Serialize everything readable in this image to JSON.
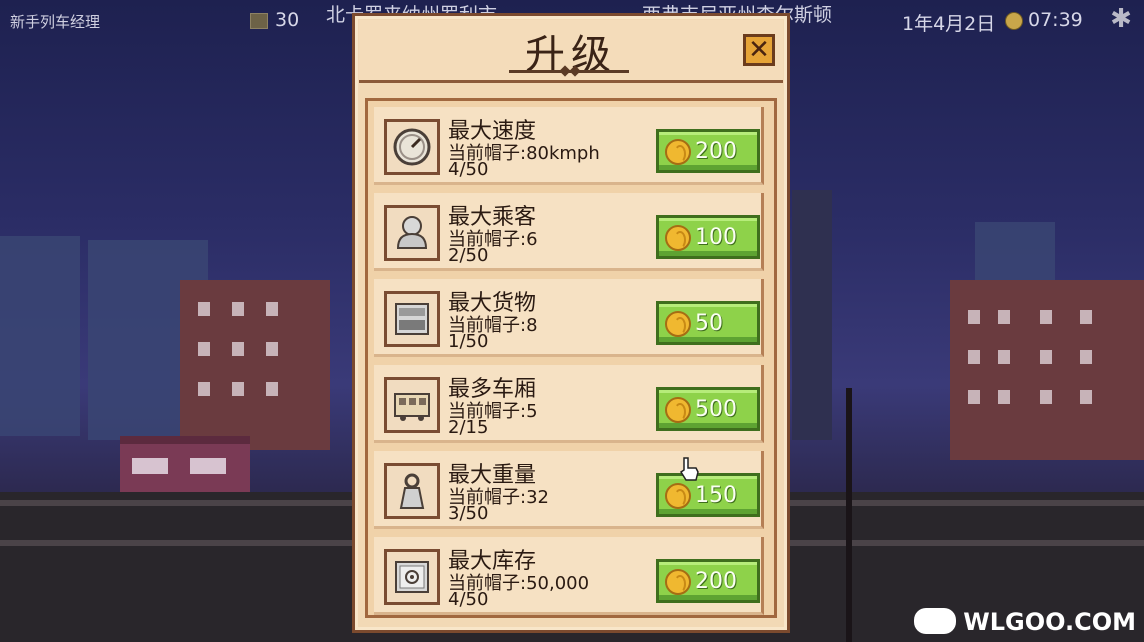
{
  "hud": {
    "rank": "新手列车经理",
    "money": "30",
    "location_left": "北卡罗来纳州罗利市",
    "location_right": "西弗吉尼亚州查尔斯顿",
    "date": "1年4月2日",
    "time": "07:39"
  },
  "panel": {
    "title": "升级",
    "close_label": "✕",
    "items": [
      {
        "name": "最大速度",
        "current": "当前帽子:80kmph",
        "level": "4/50",
        "price": "200",
        "icon": "speedometer-icon"
      },
      {
        "name": "最大乘客",
        "current": "当前帽子:6",
        "level": "2/50",
        "price": "100",
        "icon": "passenger-icon"
      },
      {
        "name": "最大货物",
        "current": "当前帽子:8",
        "level": "1/50",
        "price": "50",
        "icon": "cargo-icon"
      },
      {
        "name": "最多车厢",
        "current": "当前帽子:5",
        "level": "2/15",
        "price": "500",
        "icon": "train-car-icon"
      },
      {
        "name": "最大重量",
        "current": "当前帽子:32",
        "level": "3/50",
        "price": "150",
        "icon": "weight-icon"
      },
      {
        "name": "最大库存",
        "current": "当前帽子:50,000",
        "level": "4/50",
        "price": "200",
        "icon": "safe-icon"
      }
    ]
  },
  "watermark": "WLGOO.COM",
  "colors": {
    "panel_bg": "#f2d9b5",
    "button_green": "#8ed24a",
    "coin_gold": "#f0b830",
    "close_orange": "#e6a437"
  }
}
